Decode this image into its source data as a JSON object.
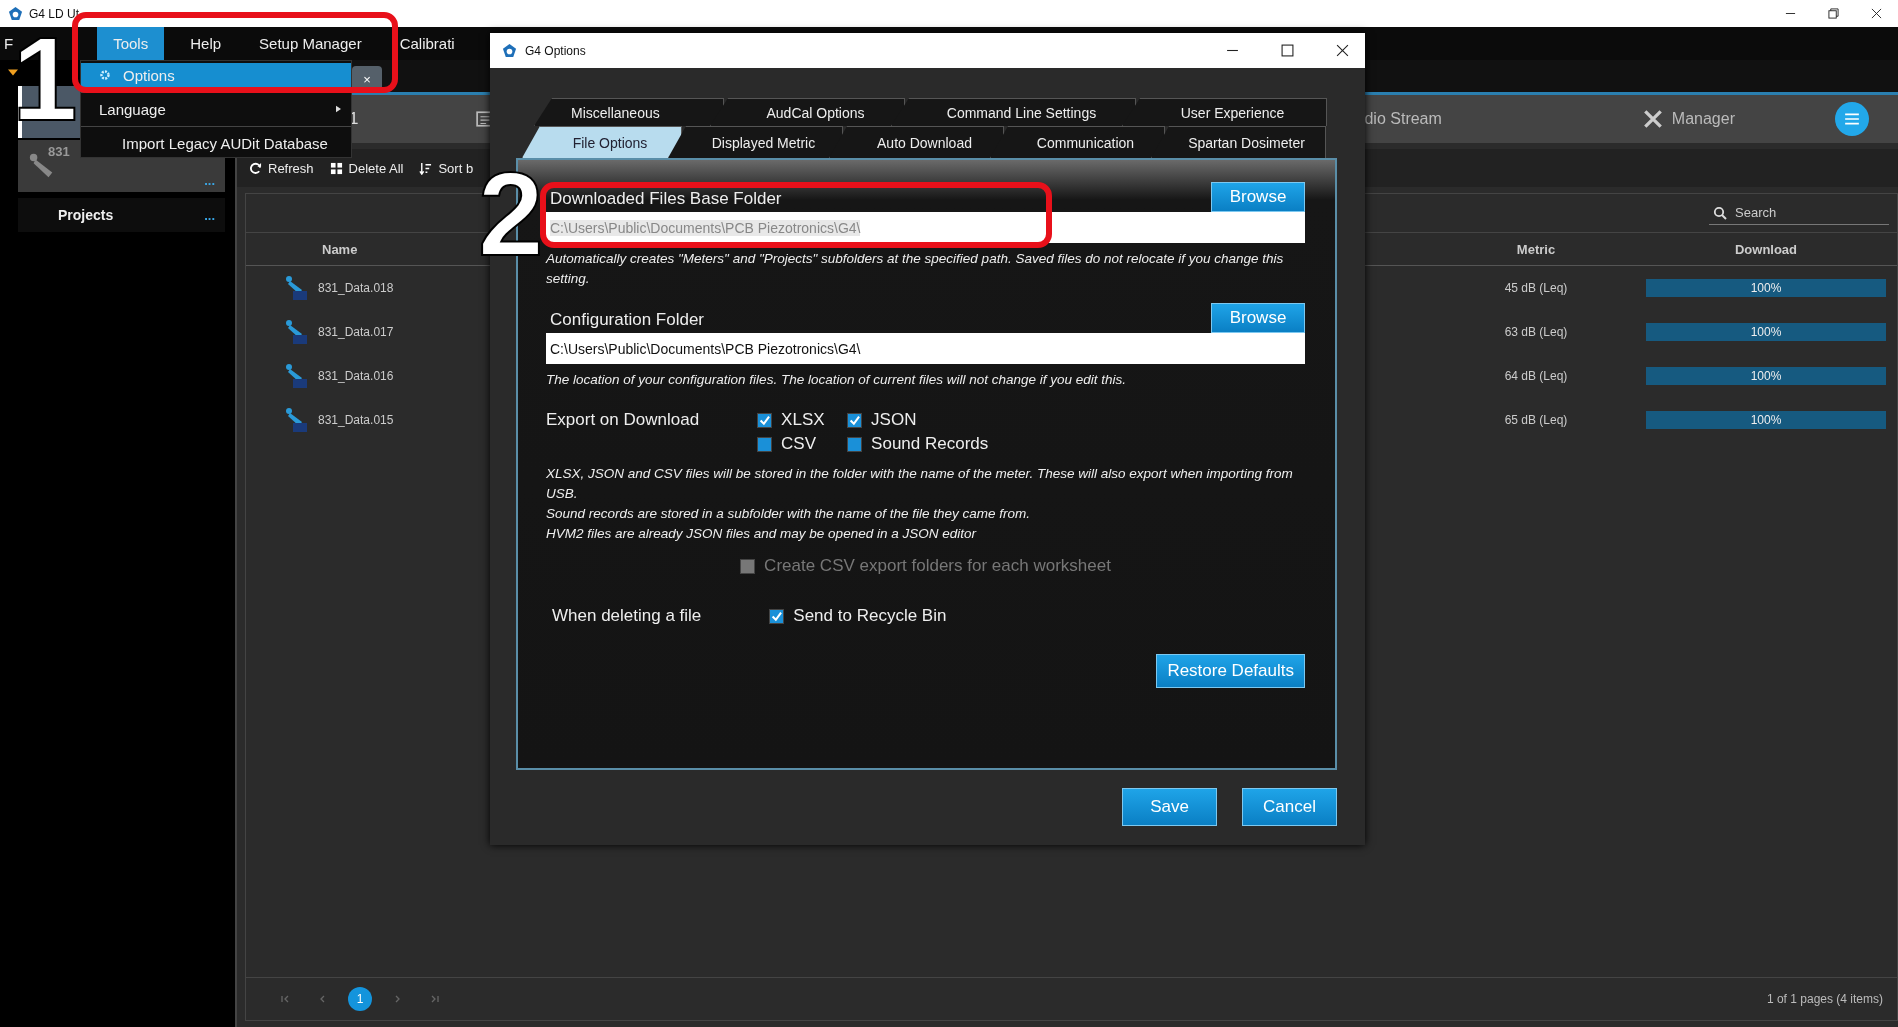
{
  "window": {
    "title": "G4 LD Ut"
  },
  "menu_bar": [
    {
      "label": "F",
      "selected": false
    },
    {
      "label": "Tools",
      "selected": true
    },
    {
      "label": "Help",
      "selected": false
    },
    {
      "label": "Setup Manager",
      "selected": false
    },
    {
      "label": "Calibrati",
      "selected": false
    }
  ],
  "document_tab": {
    "close": "×"
  },
  "tools_menu": [
    {
      "label": "Options",
      "kind": "icon",
      "selected": true
    },
    {
      "label": "Language",
      "kind": "submenu",
      "selected": false
    },
    {
      "label": "Import Legacy AUDit Database",
      "kind": "plain",
      "selected": false
    }
  ],
  "sidebar": {
    "devices": [
      {
        "selected": true
      },
      {
        "label": "831",
        "more": "...",
        "selected": false
      }
    ],
    "projects": {
      "label": "Projects",
      "more": "..."
    }
  },
  "header": {
    "fragment": "1",
    "audio_stream": "dio Stream",
    "manager": "Manager"
  },
  "toolbar": [
    "Refresh",
    "Delete All",
    "Sort b"
  ],
  "search": {
    "placeholder": "Search"
  },
  "table": {
    "columns": [
      "Name",
      "Metric",
      "Download"
    ],
    "rows": [
      {
        "name": "831_Data.018",
        "metric": "45 dB (Leq)",
        "download": "100%",
        "level": 1
      },
      {
        "name": "831_Data.017",
        "metric": "63 dB (Leq)",
        "download": "100%",
        "level": 1
      },
      {
        "name": "831_Data.016",
        "metric": "64 dB (Leq)",
        "download": "100%",
        "level": 1
      },
      {
        "name": "831_Data.015",
        "metric": "65 dB (Leq)",
        "download": "100%",
        "level": 1
      }
    ]
  },
  "pagination": {
    "page": "1",
    "summary": "1 of 1 pages (4 items)"
  },
  "dialog": {
    "title": "G4 Options",
    "tab_rows": [
      [
        {
          "label": "Miscellaneous",
          "selected": false
        },
        {
          "label": "AudCal Options",
          "selected": false
        },
        {
          "label": "Command Line Settings",
          "selected": false
        },
        {
          "label": "User Experience",
          "selected": false
        }
      ],
      [
        {
          "label": "File Options",
          "selected": true
        },
        {
          "label": "Displayed Metric",
          "selected": false
        },
        {
          "label": "Auto Download",
          "selected": false
        },
        {
          "label": "Communication",
          "selected": false
        },
        {
          "label": "Spartan Dosimeter",
          "selected": false
        }
      ]
    ],
    "folders": [
      {
        "label": "Downloaded Files Base Folder",
        "button": "Browse",
        "value": "C:\\Users\\Public\\Documents\\PCB Piezotronics\\G4\\",
        "selected": true,
        "note": "Automatically creates \"Meters\" and \"Projects\" subfolders at the specified path.  Saved files do not relocate if you change this setting."
      },
      {
        "label": "Configuration Folder",
        "button": "Browse",
        "value": "C:\\Users\\Public\\Documents\\PCB Piezotronics\\G4\\",
        "selected": false,
        "note": "The location of your configuration files. The location of current files will not change if you edit this."
      }
    ],
    "export": {
      "label": "Export on Download",
      "options": [
        {
          "label": "XLSX",
          "checked": true
        },
        {
          "label": "JSON",
          "checked": true
        },
        {
          "label": "CSV",
          "checked": false
        },
        {
          "label": "Sound Records",
          "checked": false
        }
      ],
      "notes": [
        "XLSX, JSON and CSV files will be stored in the folder with the name of the meter. These will also export when importing from USB.",
        "Sound records are stored in a subfolder with the name of the file they came from.",
        "HVM2 files are already JSON files and may be opened in a JSON editor"
      ]
    },
    "csv_folders": {
      "label": "Create CSV export folders for each worksheet",
      "checked": false,
      "disabled": true
    },
    "delete": {
      "label": "When deleting a file",
      "option": "Send to Recycle Bin",
      "checked": true
    },
    "restore_button": "Restore Defaults",
    "buttons": [
      "Save",
      "Cancel"
    ]
  },
  "annotations": [
    {
      "label": "1"
    },
    {
      "label": "2"
    }
  ]
}
